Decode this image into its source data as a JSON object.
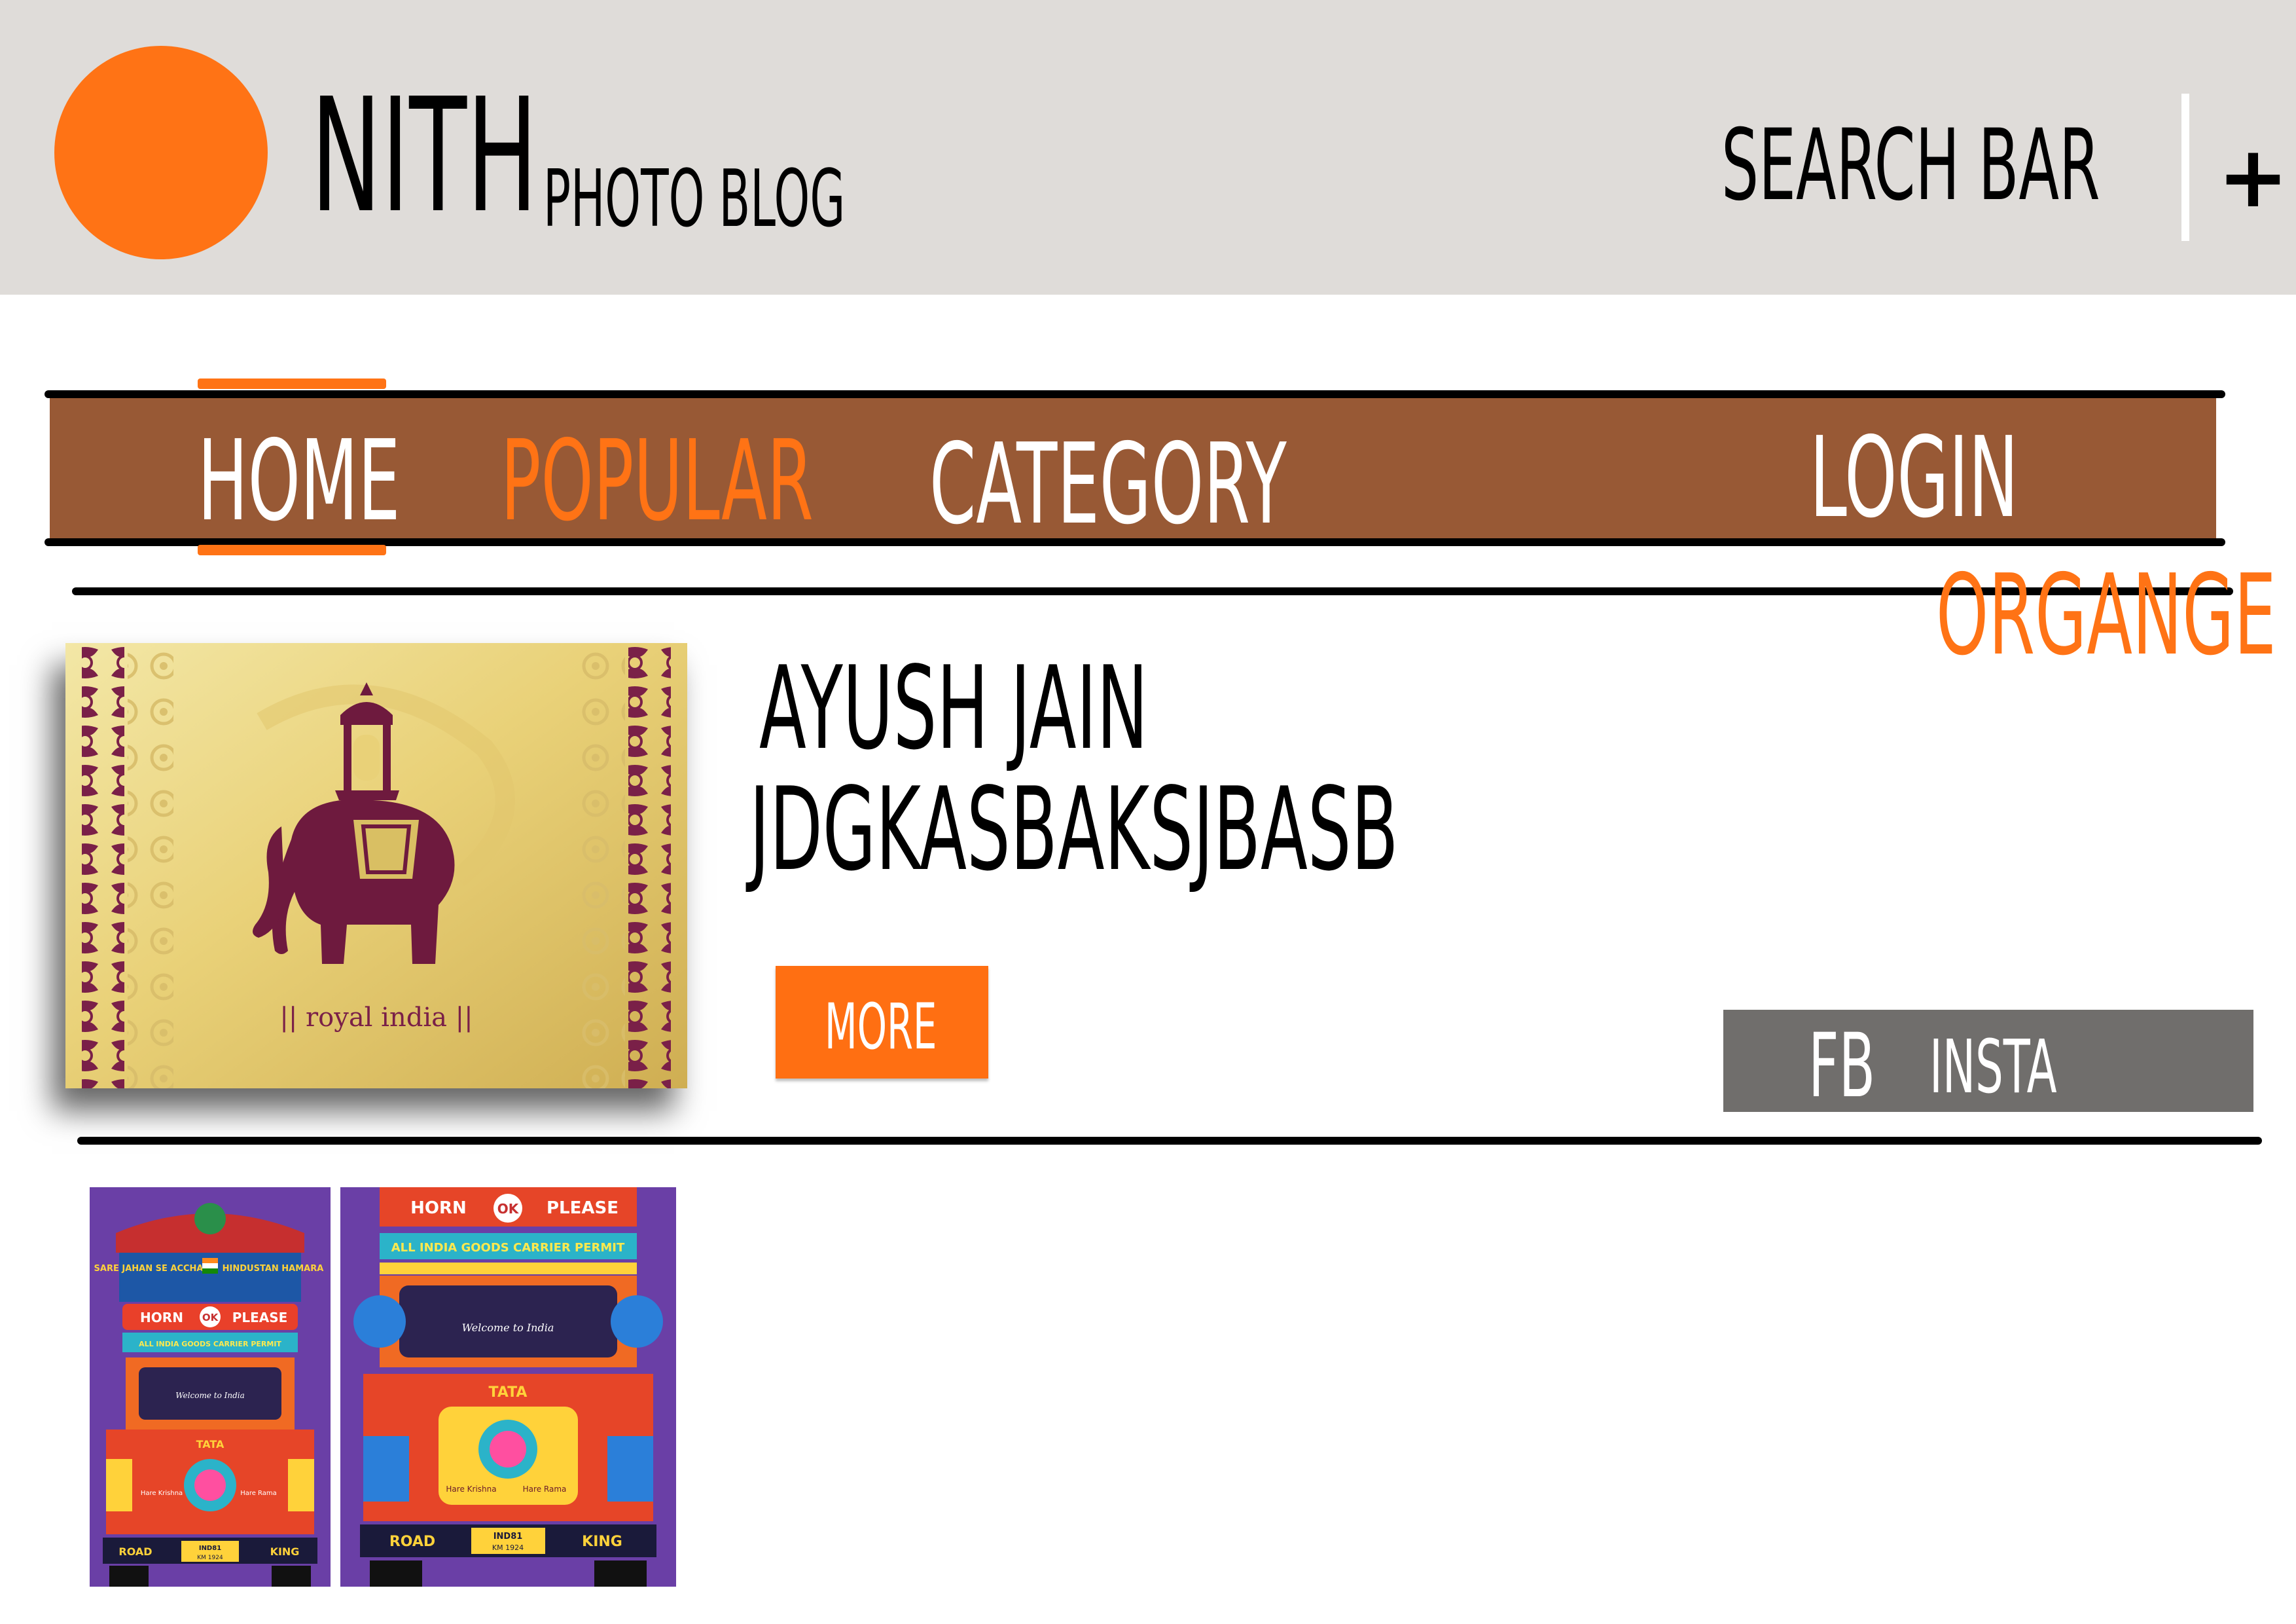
{
  "header": {
    "brand": "NITH",
    "tagline": "PHOTO BLOG",
    "search_label": "SEARCH BAR",
    "add_label": "+"
  },
  "nav": {
    "items": [
      {
        "label": "HOME"
      },
      {
        "label": "POPULAR"
      },
      {
        "label": "CATEGORY"
      },
      {
        "label": "LOGIN"
      }
    ]
  },
  "annotation": "ORGANGE",
  "post": {
    "image_caption": "|| royal india ||",
    "author": "AYUSH JAIN",
    "description": "JDGKASBAKSJBASB",
    "more_label": "MORE",
    "social": {
      "fb": "FB",
      "insta": "INSTA"
    }
  },
  "gallery": {
    "images": [
      {
        "header_left": "SARE JAHAN SE ACCHA",
        "header_right": "HINDUSTAN HAMARA",
        "horn": "HORN",
        "ok": "OK",
        "please": "PLEASE",
        "permit": "ALL INDIA GOODS CARRIER PERMIT",
        "welcome": "Welcome to India",
        "brand": "TATA",
        "left_text": "Hare Krishna",
        "right_text": "Hare Rama",
        "road": "ROAD",
        "king": "KING",
        "plate1": "IND81",
        "plate2": "KM 1924"
      },
      {
        "horn": "HORN",
        "ok": "OK",
        "please": "PLEASE",
        "permit": "ALL INDIA GOODS CARRIER PERMIT",
        "welcome": "Welcome to India",
        "brand": "TATA",
        "left_text": "Hare Krishna",
        "right_text": "Hare Rama",
        "road": "ROAD",
        "king": "KING",
        "plate1": "IND81",
        "plate2": "KM 1924"
      }
    ]
  },
  "colors": {
    "accent": "#ff7315",
    "header_bg": "#dfdcd9",
    "nav_bg": "#985935",
    "social_bg": "#706e6c",
    "gallery_bg": "#6a3fa6"
  }
}
